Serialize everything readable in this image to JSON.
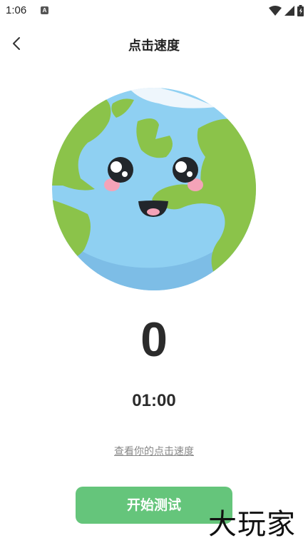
{
  "status_bar": {
    "time": "1:06",
    "app_icon_letter": "A",
    "icons": [
      "wifi-icon",
      "signal-icon",
      "battery-icon"
    ]
  },
  "header": {
    "title": "点击速度",
    "back_icon": "chevron-left-icon"
  },
  "main": {
    "illustration": "earth-mascot",
    "count": "0",
    "timer": "01:00",
    "view_speed_link": "查看你的点击速度",
    "start_button": "开始测试"
  },
  "watermark": "大玩家",
  "colors": {
    "accent": "#65c57b",
    "ocean": "#8fd0f2",
    "land": "#8bc34a",
    "text": "#2b2b2b",
    "link": "#888888"
  }
}
